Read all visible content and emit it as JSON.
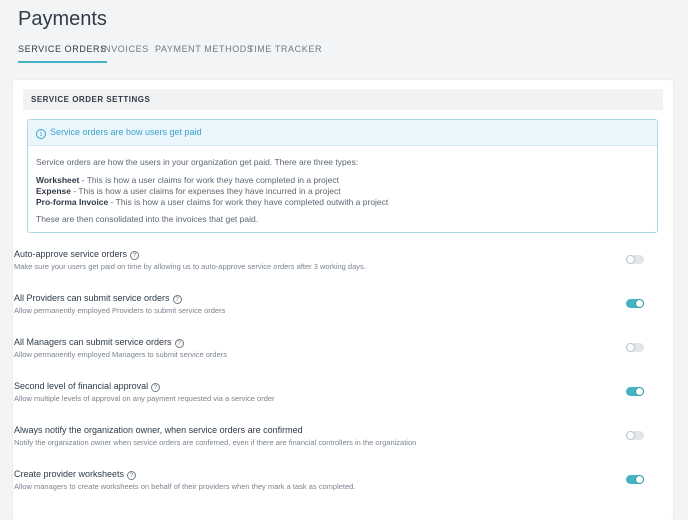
{
  "page": {
    "title": "Payments"
  },
  "tabs": [
    {
      "label": "SERVICE ORDERS",
      "active": true
    },
    {
      "label": "INVOICES",
      "active": false
    },
    {
      "label": "PAYMENT METHODS",
      "active": false
    },
    {
      "label": "TIME TRACKER",
      "active": false
    }
  ],
  "section": {
    "title": "SERVICE ORDER SETTINGS"
  },
  "info": {
    "heading": "Service orders are how users get paid",
    "intro": "Service orders are how the users in your organization get paid. There are three types:",
    "types": [
      {
        "name": "Worksheet",
        "text": " - This is how a user claims for work they have completed in a project"
      },
      {
        "name": "Expense",
        "text": " - This is how a user claims for expenses they have incurred in a project"
      },
      {
        "name": "Pro-forma Invoice",
        "text": " - This is how a user claims for work they have completed outwith a project"
      }
    ],
    "outro": "These are then consolidated into the invoices that get paid."
  },
  "settings": [
    {
      "title": "Auto-approve service orders",
      "description": "Make sure your users get paid on time by allowing us to auto-approve service orders after 3 working days.",
      "enabled": false
    },
    {
      "title": "All Providers can submit service orders",
      "description": "Allow permanently employed Providers to submit service orders",
      "enabled": true
    },
    {
      "title": "All Managers can submit service orders",
      "description": "Allow permanently employed Managers to submit service orders",
      "enabled": false
    },
    {
      "title": "Second level of financial approval",
      "description": "Allow multiple levels of approval on any payment requested via a service order",
      "enabled": true
    },
    {
      "title": "Always notify the organization owner, when service orders are confirmed",
      "description": "Notify the organization owner when service orders are confirmed, even if there are financial controllers in the organization",
      "enabled": false
    },
    {
      "title": "Create provider worksheets",
      "description": "Allow managers to create worksheets on behalf of their providers when they mark a task as completed.",
      "enabled": true
    }
  ],
  "colors": {
    "accent": "#45b3c4",
    "info": "#3aa3c9"
  }
}
